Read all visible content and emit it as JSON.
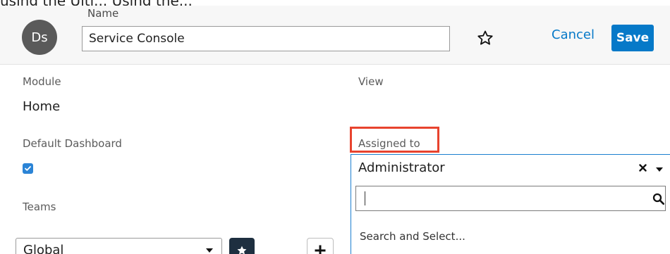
{
  "top_partial_text": "using the Ulti... Using the...",
  "header": {
    "avatar_initials": "Ds",
    "name_label": "Name",
    "name_value": "Service Console",
    "favorite_icon": "star-outline-icon",
    "cancel_label": "Cancel",
    "save_label": "Save"
  },
  "form": {
    "module_label": "Module",
    "module_value": "Home",
    "view_label": "View",
    "default_dashboard_label": "Default Dashboard",
    "default_dashboard_checked": true,
    "assigned_to_label": "Assigned to",
    "teams_label": "Teams",
    "teams_value": "Global"
  },
  "assigned_dropdown": {
    "selected_value": "Administrator",
    "search_value": "",
    "hint": "Search and Select..."
  },
  "colors": {
    "accent": "#0679c8",
    "avatar_bg": "#5a5a5a",
    "highlight": "#e8432e",
    "primary_team_button_bg": "#1e2f40",
    "checkbox": "#2b84d6"
  }
}
